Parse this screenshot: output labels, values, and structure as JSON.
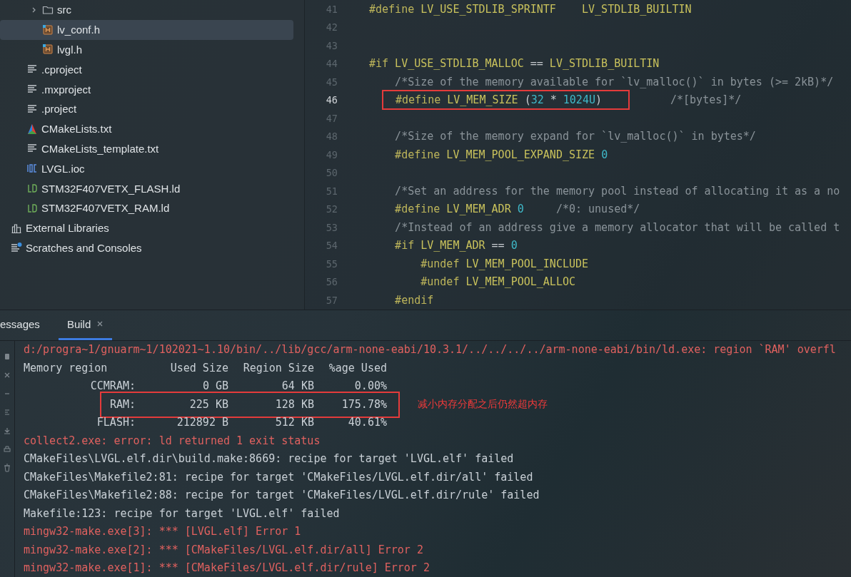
{
  "project_tree": {
    "items": [
      {
        "children": [
          {
            "children": [
              {
                "name": "src",
                "kind": "folder",
                "expanded": false,
                "selected": false
              },
              {
                "name": "lv_conf.h",
                "kind": "header",
                "selected": true
              },
              {
                "name": "lvgl.h",
                "kind": "header",
                "selected": false
              }
            ]
          },
          {
            "name": ".cproject",
            "kind": "text",
            "selected": false
          },
          {
            "name": ".mxproject",
            "kind": "text",
            "selected": false
          },
          {
            "name": ".project",
            "kind": "text",
            "selected": false
          },
          {
            "name": "CMakeLists.txt",
            "kind": "cmake",
            "selected": false
          },
          {
            "name": "CMakeLists_template.txt",
            "kind": "text",
            "selected": false
          },
          {
            "name": "LVGL.ioc",
            "kind": "ioc",
            "selected": false
          },
          {
            "name": "STM32F407VETX_FLASH.ld",
            "kind": "ld",
            "selected": false
          },
          {
            "name": "STM32F407VETX_RAM.ld",
            "kind": "ld",
            "selected": false
          }
        ]
      },
      {
        "name": "External Libraries",
        "kind": "libraries",
        "selected": false
      },
      {
        "name": "Scratches and Consoles",
        "kind": "scratches",
        "selected": false
      }
    ]
  },
  "editor": {
    "lines": [
      {
        "number": "41",
        "current": false,
        "highlighted": false,
        "segments": [
          {
            "kind": "directive",
            "text": "#define"
          },
          {
            "kind": "macro",
            "text": " LV_USE_STDLIB_SPRINTF    LV_STDLIB_BUILTIN"
          }
        ]
      },
      {
        "number": "42",
        "current": false,
        "highlighted": false
      },
      {
        "number": "43",
        "current": false,
        "highlighted": false
      },
      {
        "number": "44",
        "current": false,
        "highlighted": false,
        "segments": [
          {
            "kind": "directive",
            "text": "#if"
          },
          {
            "kind": "macro",
            "text": " LV_USE_STDLIB_MALLOC "
          },
          {
            "kind": "plain",
            "text": "=="
          },
          {
            "kind": "macro",
            "text": " LV_STDLIB_BUILTIN"
          }
        ]
      },
      {
        "number": "45",
        "current": false,
        "highlighted": false,
        "segments": [
          {
            "kind": "comment",
            "text": "    /*Size of the memory available for `lv_malloc()` in bytes (>= 2kB)*/"
          }
        ]
      },
      {
        "number": "46",
        "current": true,
        "highlighted": true,
        "segments": [
          {
            "kind": "directive",
            "text": "#define"
          },
          {
            "kind": "macro",
            "text": " LV_MEM_SIZE "
          },
          {
            "kind": "plain",
            "text": "("
          },
          {
            "kind": "number",
            "text": "32"
          },
          {
            "kind": "plain",
            "text": " * "
          },
          {
            "kind": "number",
            "text": "1024U"
          },
          {
            "kind": "plain",
            "text": ")"
          }
        ],
        "trailing": [
          {
            "kind": "comment",
            "text": "/*[bytes]*/"
          }
        ]
      },
      {
        "number": "47",
        "current": false,
        "highlighted": false
      },
      {
        "number": "48",
        "current": false,
        "highlighted": false,
        "segments": [
          {
            "kind": "comment",
            "text": "    /*Size of the memory expand for `lv_malloc()` in bytes*/"
          }
        ]
      },
      {
        "number": "49",
        "current": false,
        "highlighted": false,
        "segments": [
          {
            "kind": "directive",
            "text": "    #define"
          },
          {
            "kind": "macro",
            "text": " LV_MEM_POOL_EXPAND_SIZE "
          },
          {
            "kind": "number",
            "text": "0"
          }
        ]
      },
      {
        "number": "50",
        "current": false,
        "highlighted": false
      },
      {
        "number": "51",
        "current": false,
        "highlighted": false,
        "segments": [
          {
            "kind": "comment",
            "text": "    /*Set an address for the memory pool instead of allocating it as a no"
          }
        ]
      },
      {
        "number": "52",
        "current": false,
        "highlighted": false,
        "segments": [
          {
            "kind": "directive",
            "text": "    #define"
          },
          {
            "kind": "macro",
            "text": " LV_MEM_ADR "
          },
          {
            "kind": "number",
            "text": "0"
          },
          {
            "kind": "comment",
            "text": "     /*0: unused*/"
          }
        ]
      },
      {
        "number": "53",
        "current": false,
        "highlighted": false,
        "segments": [
          {
            "kind": "comment",
            "text": "    /*Instead of an address give a memory allocator that will be called t"
          }
        ]
      },
      {
        "number": "54",
        "current": false,
        "highlighted": false,
        "segments": [
          {
            "kind": "directive",
            "text": "    #if"
          },
          {
            "kind": "macro",
            "text": " LV_MEM_ADR "
          },
          {
            "kind": "plain",
            "text": "== "
          },
          {
            "kind": "number",
            "text": "0"
          }
        ]
      },
      {
        "number": "55",
        "current": false,
        "highlighted": false,
        "segments": [
          {
            "kind": "directive",
            "text": "        #undef"
          },
          {
            "kind": "macro",
            "text": " LV_MEM_POOL_INCLUDE"
          }
        ]
      },
      {
        "number": "56",
        "current": false,
        "highlighted": false,
        "segments": [
          {
            "kind": "directive",
            "text": "        #undef"
          },
          {
            "kind": "macro",
            "text": " LV_MEM_POOL_ALLOC"
          }
        ]
      },
      {
        "number": "57",
        "current": false,
        "highlighted": false,
        "segments": [
          {
            "kind": "directive",
            "text": "    #endif"
          }
        ]
      }
    ]
  },
  "build_panel": {
    "tabs": [
      {
        "label": "essages",
        "selected": false,
        "closable": false
      },
      {
        "label": "Build",
        "selected": true,
        "closable": true
      }
    ],
    "output": [
      {
        "kind": "error",
        "text": "d:/progra~1/gnuarm~1/102021~1.10/bin/../lib/gcc/arm-none-eabi/10.3.1/../../../../arm-none-eabi/bin/ld.exe: region `RAM' overfl"
      },
      {
        "kind": "table_header",
        "cells": [
          "Memory region",
          "Used Size",
          "Region Size",
          "%age Used"
        ]
      },
      {
        "kind": "table_row",
        "highlighted": false,
        "cells": [
          "CCMRAM:",
          "0 GB",
          "64 KB",
          "0.00%"
        ]
      },
      {
        "kind": "table_row",
        "highlighted": true,
        "note": "减小内存分配之后仍然超内存",
        "cells": [
          "RAM:",
          "225 KB",
          "128 KB",
          "175.78%"
        ]
      },
      {
        "kind": "table_row",
        "highlighted": false,
        "cells": [
          "FLASH:",
          "212892 B",
          "512 KB",
          "40.61%"
        ]
      },
      {
        "kind": "error",
        "text": "collect2.exe: error: ld returned 1 exit status"
      },
      {
        "kind": "normal",
        "text": "CMakeFiles\\LVGL.elf.dir\\build.make:8669: recipe for target 'LVGL.elf' failed"
      },
      {
        "kind": "normal",
        "text": "CMakeFiles\\Makefile2:81: recipe for target 'CMakeFiles/LVGL.elf.dir/all' failed"
      },
      {
        "kind": "normal",
        "text": "CMakeFiles\\Makefile2:88: recipe for target 'CMakeFiles/LVGL.elf.dir/rule' failed"
      },
      {
        "kind": "normal",
        "text": "Makefile:123: recipe for target 'LVGL.elf' failed"
      },
      {
        "kind": "error",
        "text": "mingw32-make.exe[3]: *** [LVGL.elf] Error 1"
      },
      {
        "kind": "error",
        "text": "mingw32-make.exe[2]: *** [CMakeFiles/LVGL.elf.dir/all] Error 2"
      },
      {
        "kind": "error",
        "text": "mingw32-make.exe[1]: *** [CMakeFiles/LVGL.elf.dir/rule] Error 2"
      }
    ]
  }
}
